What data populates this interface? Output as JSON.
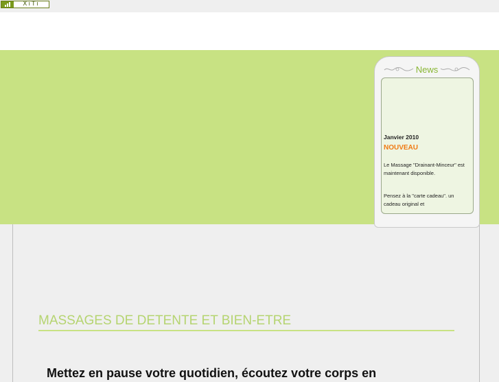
{
  "counter": {
    "label": "XiTi"
  },
  "news": {
    "title": "News",
    "date": "Janvier 2010",
    "tag": "NOUVEAU",
    "paragraph1": "Le Massage \"Drainant-Minceur\" est maintenant disponible.",
    "paragraph2": "Pensez à la \"carte cadeau\". un cadeau original et"
  },
  "main": {
    "heading": "MASSAGES DE DETENTE ET BIEN-ETRE",
    "intro": "Mettez en pause votre quotidien, écoutez votre corps en"
  },
  "colors": {
    "green_band": "#c8e283",
    "heading": "#b5d470",
    "news_tag": "#f07a12",
    "news_title": "#89b634"
  }
}
